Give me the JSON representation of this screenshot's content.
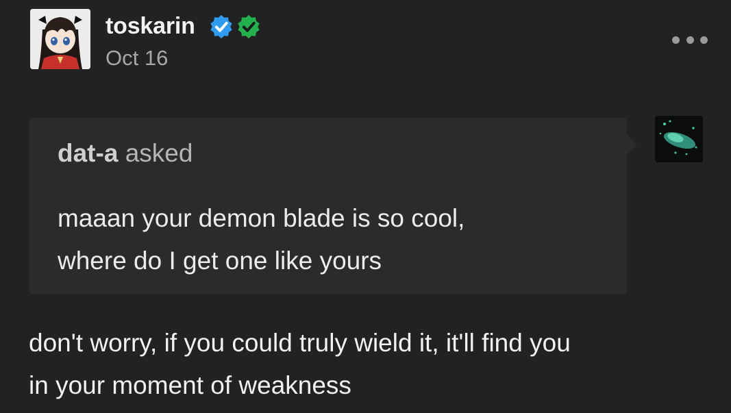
{
  "post": {
    "author": {
      "username": "toskarin",
      "avatar_icon": "anime-figure-avatar-icon",
      "badges": [
        {
          "icon": "verified-check-badge-icon",
          "color": "#2f9bf0"
        },
        {
          "icon": "verified-check-badge-icon",
          "color": "#22b14c"
        }
      ]
    },
    "date": "Oct 16",
    "menu_icon": "more-options-icon",
    "ask": {
      "asker_name": "dat-a",
      "asked_label": "asked",
      "asker_avatar_icon": "asker-avatar-icon",
      "question": "maaan your demon blade is so cool,\nwhere do I get one like yours"
    },
    "answer": "don't worry, if you could truly wield it, it'll find you\nin your moment of weakness"
  },
  "colors": {
    "background": "#222222",
    "ask_box": "#2b2b2b",
    "text_primary": "#f2f2f2",
    "text_secondary": "#a8a8a8"
  }
}
